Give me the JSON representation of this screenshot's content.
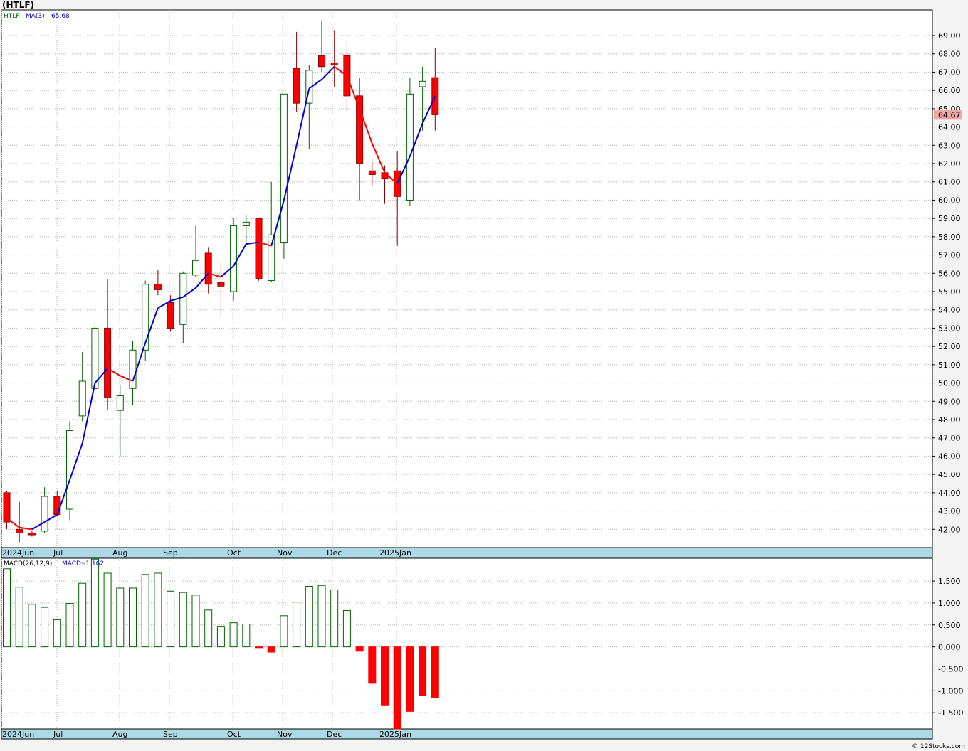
{
  "header": {
    "title": "(HTLF)",
    "price_legend": {
      "symbol": "HTLF",
      "ma_label": "MA(3)",
      "ma_value": "65.68"
    },
    "macd_legend": {
      "label": "MACD(26,12,9)",
      "value": "MACD:-1.162"
    },
    "last_price": "64.67",
    "watermark": "© 12Stocks.com"
  },
  "colors": {
    "up": "#006400",
    "down": "#ff0000",
    "ma_up": "#0000cc",
    "ma_down": "#ff0000",
    "axis_band": "#add8e6",
    "last_price_bg": "#f4a6a6"
  },
  "chart_data": [
    {
      "type": "candlestick",
      "name": "price",
      "interval": "weekly",
      "ylim": [
        41.0,
        70.4
      ],
      "y_ticks": [
        "42.00",
        "43.00",
        "44.00",
        "45.00",
        "46.00",
        "47.00",
        "48.00",
        "49.00",
        "50.00",
        "51.00",
        "52.00",
        "53.00",
        "54.00",
        "55.00",
        "56.00",
        "57.00",
        "58.00",
        "59.00",
        "60.00",
        "61.00",
        "62.00",
        "63.00",
        "64.00",
        "65.00",
        "66.00",
        "67.00",
        "68.00",
        "69.00"
      ],
      "x_labels": [
        "2024Jun",
        "Jul",
        "Aug",
        "Sep",
        "Oct",
        "Nov",
        "Dec",
        "2025Jan"
      ],
      "ohlc": [
        [
          44.0,
          44.1,
          42.0,
          42.4
        ],
        [
          42.0,
          43.5,
          41.3,
          41.8
        ],
        [
          41.8,
          41.9,
          41.6,
          41.7
        ],
        [
          41.9,
          44.3,
          41.8,
          43.8
        ],
        [
          43.8,
          44.1,
          42.7,
          42.8
        ],
        [
          43.1,
          47.9,
          42.5,
          47.4
        ],
        [
          48.2,
          51.7,
          47.9,
          50.1
        ],
        [
          49.7,
          53.2,
          49.3,
          53.0
        ],
        [
          53.0,
          55.7,
          48.5,
          49.2
        ],
        [
          48.5,
          49.9,
          46.0,
          49.3
        ],
        [
          49.7,
          52.3,
          48.8,
          51.8
        ],
        [
          51.8,
          55.6,
          51.2,
          55.4
        ],
        [
          55.4,
          56.2,
          54.8,
          55.1
        ],
        [
          54.4,
          54.8,
          52.8,
          53.0
        ],
        [
          53.2,
          56.1,
          52.2,
          56.0
        ],
        [
          55.9,
          58.6,
          55.8,
          56.7
        ],
        [
          57.1,
          57.4,
          54.9,
          55.4
        ],
        [
          55.5,
          56.6,
          53.6,
          55.3
        ],
        [
          55.0,
          59.0,
          54.5,
          58.6
        ],
        [
          58.6,
          59.2,
          57.7,
          58.8
        ],
        [
          59.0,
          59.0,
          55.6,
          55.7
        ],
        [
          55.6,
          61.0,
          55.5,
          58.1
        ],
        [
          57.7,
          60.9,
          56.8,
          65.8
        ],
        [
          67.2,
          69.2,
          64.8,
          65.3
        ],
        [
          65.3,
          67.4,
          62.8,
          67.1
        ],
        [
          67.9,
          69.8,
          67.0,
          67.3
        ],
        [
          67.5,
          69.3,
          66.2,
          67.4
        ],
        [
          67.9,
          68.6,
          64.8,
          65.7
        ],
        [
          65.7,
          66.7,
          60.0,
          62.0
        ],
        [
          61.6,
          62.1,
          60.8,
          61.4
        ],
        [
          61.5,
          61.9,
          59.8,
          61.2
        ],
        [
          61.6,
          62.7,
          57.5,
          60.2
        ],
        [
          60.0,
          66.7,
          59.7,
          65.8
        ],
        [
          66.2,
          67.3,
          63.8,
          66.5
        ],
        [
          66.7,
          68.3,
          63.8,
          64.67
        ]
      ],
      "ma": {
        "name": "MA(3)",
        "values": [
          42.6,
          42.1,
          42.0,
          42.4,
          42.8,
          44.7,
          46.7,
          50.0,
          50.8,
          50.4,
          50.1,
          52.2,
          54.1,
          54.5,
          54.7,
          55.2,
          56.0,
          55.8,
          56.4,
          57.6,
          57.7,
          57.5,
          60.0,
          63.0,
          66.1,
          66.6,
          67.3,
          66.8,
          65.0,
          63.1,
          61.5,
          60.9,
          62.4,
          64.2,
          65.68
        ]
      }
    },
    {
      "type": "bar",
      "name": "MACD(26,12,9)",
      "ylim": [
        -1.87,
        2.02
      ],
      "y_ticks": [
        "1.500",
        "1.000",
        "0.500",
        "0.000",
        "-0.500",
        "-1.000",
        "-1.500"
      ],
      "x_labels": [
        "2024Jun",
        "Jul",
        "Aug",
        "Sep",
        "Oct",
        "Nov",
        "Dec",
        "2025Jan"
      ],
      "values": [
        1.78,
        1.36,
        0.97,
        0.9,
        0.62,
        0.99,
        1.45,
        2.0,
        1.68,
        1.34,
        1.34,
        1.65,
        1.68,
        1.27,
        1.24,
        1.18,
        0.84,
        0.47,
        0.55,
        0.52,
        -0.02,
        -0.12,
        0.71,
        1.02,
        1.38,
        1.4,
        1.3,
        0.83,
        -0.1,
        -0.83,
        -1.34,
        -1.87,
        -1.47,
        -1.1,
        -1.162
      ]
    }
  ]
}
